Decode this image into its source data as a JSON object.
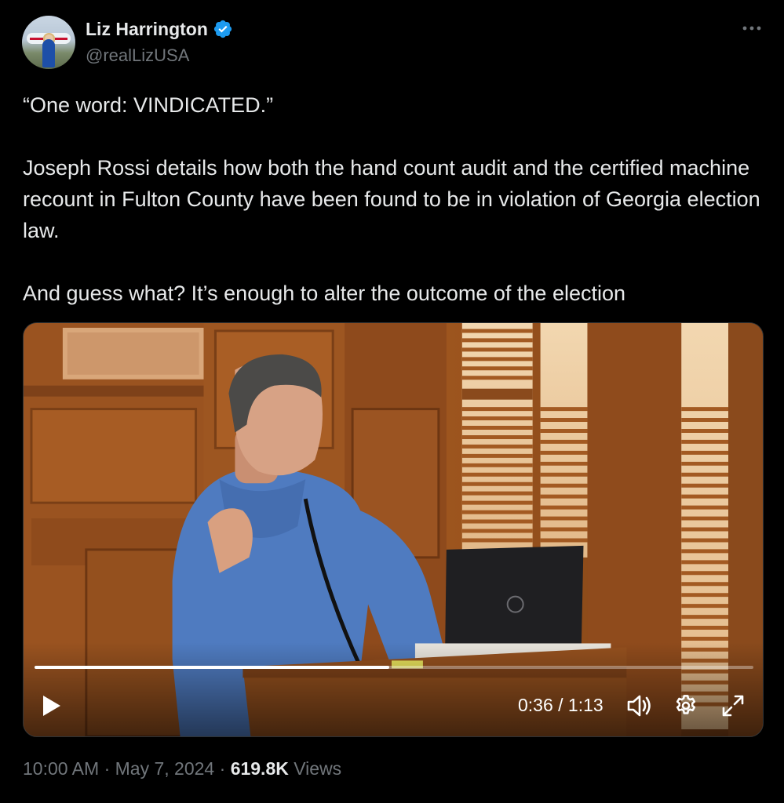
{
  "author": {
    "display_name": "Liz Harrington",
    "handle": "@realLizUSA",
    "verified": true
  },
  "tweet": {
    "paragraphs": [
      "“One word: VINDICATED.”",
      "Joseph Rossi details how both the hand count audit and the certified machine recount in Fulton County have been found to be in violation of Georgia election law.",
      "And guess what? It’s enough to alter the outcome of the election"
    ]
  },
  "video": {
    "time_display": "0:36 / 1:13",
    "current_time": "0:36",
    "duration": "1:13",
    "progress_fraction": 0.493
  },
  "footer": {
    "time": "10:00 AM",
    "separator": "·",
    "date": "May 7, 2024",
    "views_count": "619.8K",
    "views_label": "Views"
  },
  "icons": {
    "more": "more-horizontal-icon",
    "verified": "verified-badge-icon",
    "play": "play-icon",
    "volume": "volume-icon",
    "settings": "gear-icon",
    "fullscreen": "fullscreen-icon"
  },
  "colors": {
    "background": "#000000",
    "text_primary": "#e7e9ea",
    "text_secondary": "#71767b",
    "verified_blue": "#1d9bf0"
  }
}
